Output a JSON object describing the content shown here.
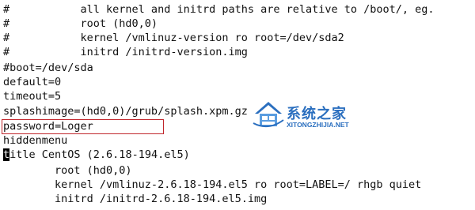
{
  "editor": {
    "lines": [
      "#           all kernel and initrd paths are relative to /boot/, eg.",
      "#           root (hd0,0)",
      "#           kernel /vmlinuz-version ro root=/dev/sda2",
      "#           initrd /initrd-version.img",
      "#boot=/dev/sda",
      "default=0",
      "timeout=5",
      "splashimage=(hd0,0)/grub/splash.xpm.gz",
      "password=Loger",
      "hiddenmenu",
      "itle CentOS (2.6.18-194.el5)",
      "        root (hd0,0)",
      "        kernel /vmlinuz-2.6.18-194.el5 ro root=LABEL=/ rhgb quiet",
      "        initrd /initrd-2.6.18-194.el5.img"
    ],
    "cursor_char": "t"
  },
  "watermark": {
    "site_name": "系统之家",
    "site_url": "XITONGZHIJIA.NET",
    "logo_icon": "house-logo-icon",
    "brand_color": "#2b6fbf"
  },
  "highlight": {
    "color": "#c0262c"
  }
}
